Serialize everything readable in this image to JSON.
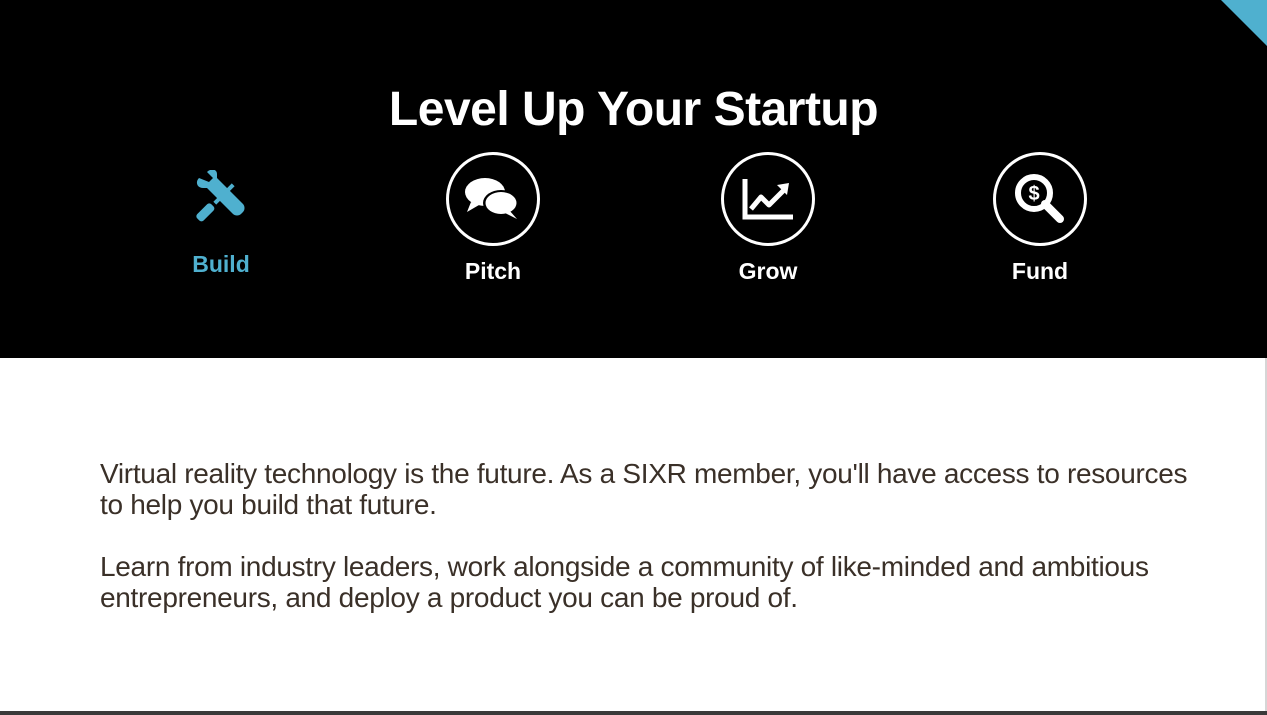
{
  "hero": {
    "title": "Level Up Your Startup",
    "accent_color": "#4fb0cf",
    "tabs": [
      {
        "label": "Build",
        "icon": "tools-icon",
        "active": true
      },
      {
        "label": "Pitch",
        "icon": "chat-bubbles-icon",
        "active": false
      },
      {
        "label": "Grow",
        "icon": "growth-chart-icon",
        "active": false
      },
      {
        "label": "Fund",
        "icon": "dollar-magnifier-icon",
        "active": false
      }
    ]
  },
  "content": {
    "paragraphs": [
      "Virtual reality technology is the future. As a SIXR member, you'll have access to resources to help you build that future.",
      "Learn from industry leaders, work alongside a community of like-minded and ambitious entrepreneurs, and deploy a product you can be proud of."
    ]
  }
}
